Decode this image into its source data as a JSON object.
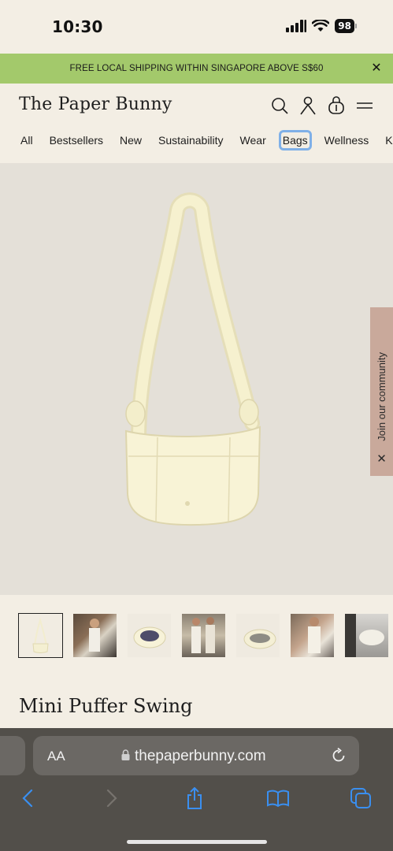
{
  "status": {
    "time": "10:30",
    "battery": "98"
  },
  "announcement": {
    "text": "FREE LOCAL SHIPPING WITHIN SINGAPORE ABOVE S$60",
    "close": "✕"
  },
  "header": {
    "logo": "The Paper Bunny",
    "nav": [
      "All",
      "Bestsellers",
      "New",
      "Sustainability",
      "Wear",
      "Bags",
      "Wellness",
      "Kids"
    ],
    "active_nav": "Bags"
  },
  "community_tab": {
    "label": "Join our community",
    "close": "✕"
  },
  "product": {
    "title": "Mini Puffer Swing"
  },
  "browser": {
    "aa": "AA",
    "url": "thepaperbunny.com"
  },
  "colors": {
    "announcement_bg": "#a3c96b",
    "page_bg": "#f3eee4",
    "gallery_bg": "#e4e0d8",
    "community_bg": "#c9a99b",
    "browser_bg": "#524f4a",
    "accent_blue": "#3a8ff0"
  }
}
